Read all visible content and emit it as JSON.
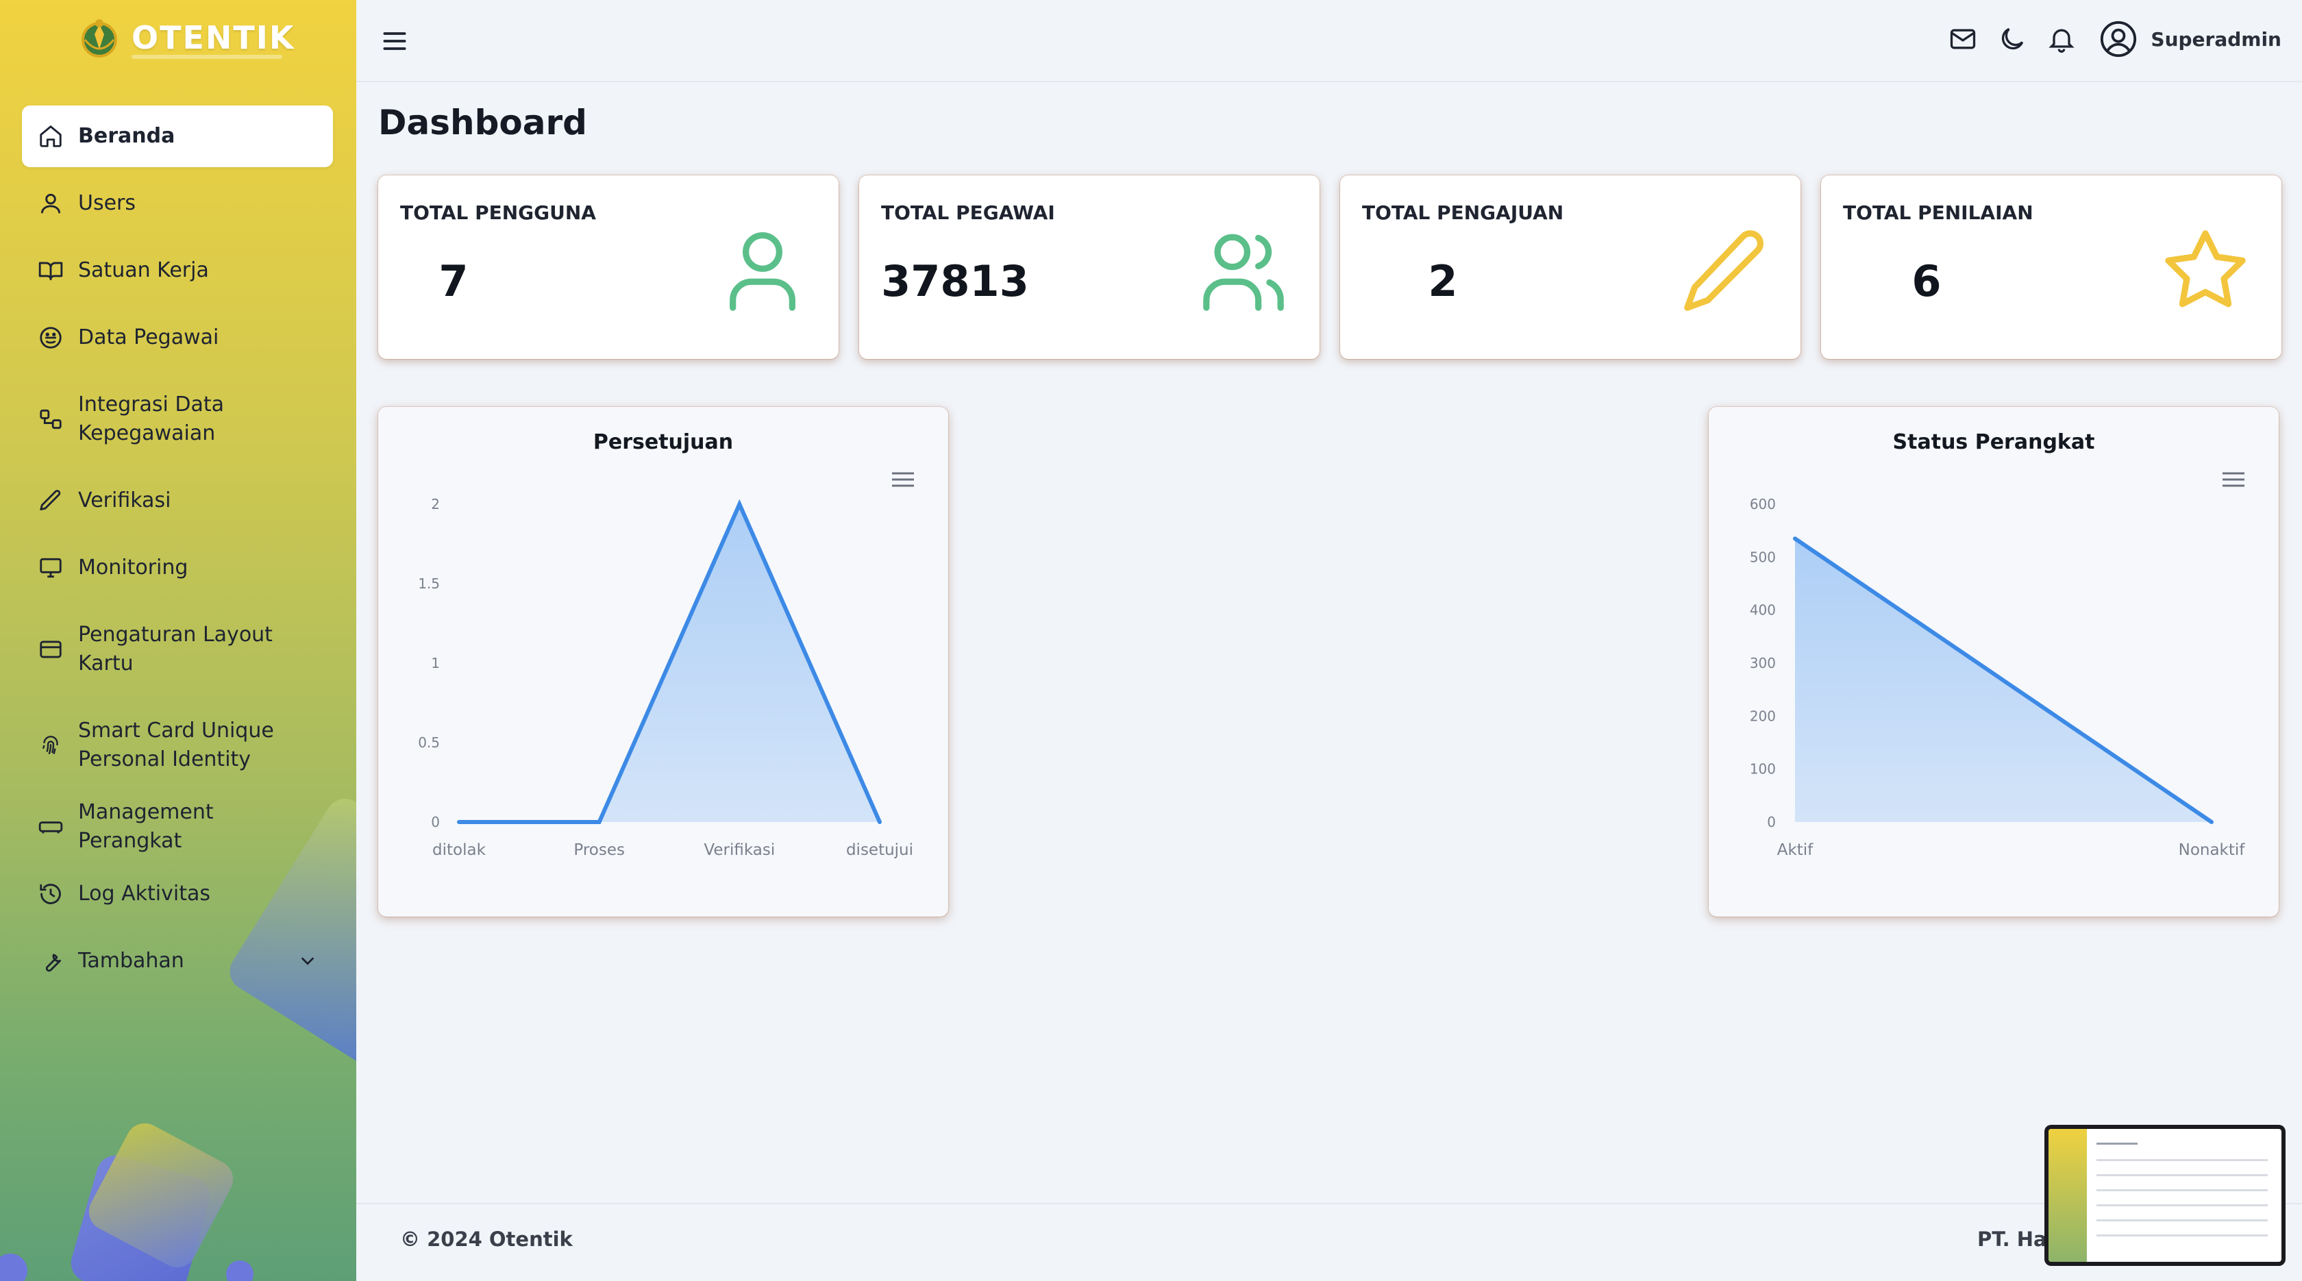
{
  "app": {
    "brand": "OTENTIK"
  },
  "sidebar": {
    "items": [
      {
        "label": "Beranda",
        "icon": "home-icon",
        "active": true
      },
      {
        "label": "Users",
        "icon": "user-icon"
      },
      {
        "label": "Satuan Kerja",
        "icon": "book-icon"
      },
      {
        "label": "Data Pegawai",
        "icon": "smile-icon"
      },
      {
        "label": "Integrasi Data\nKepegawaian",
        "icon": "integration-icon"
      },
      {
        "label": "Verifikasi",
        "icon": "pencil-icon"
      },
      {
        "label": "Monitoring",
        "icon": "monitor-icon"
      },
      {
        "label": "Pengaturan Layout\nKartu",
        "icon": "card-icon"
      },
      {
        "label": "Smart Card Unique\nPersonal Identity",
        "icon": "fingerprint-icon"
      },
      {
        "label": "Management Perangkat",
        "icon": "device-icon"
      },
      {
        "label": "Log Aktivitas",
        "icon": "history-icon"
      },
      {
        "label": "Tambahan",
        "icon": "wrench-icon",
        "has_submenu": true
      }
    ]
  },
  "header": {
    "icons": [
      "menu-icon",
      "mail-icon",
      "moon-icon",
      "bell-icon",
      "user-circle-icon"
    ],
    "username": "Superadmin"
  },
  "main": {
    "title": "Dashboard",
    "stats": [
      {
        "label": "TOTAL PENGGUNA",
        "value": "7",
        "icon": "user-icon",
        "color": "#5bbf8a"
      },
      {
        "label": "TOTAL PEGAWAI",
        "value": "37813",
        "icon": "users-icon",
        "color": "#5bbf8a"
      },
      {
        "label": "TOTAL PENGAJUAN",
        "value": "2",
        "icon": "pencil-icon",
        "color": "#f2c53d"
      },
      {
        "label": "TOTAL PENILAIAN",
        "value": "6",
        "icon": "star-icon",
        "color": "#f2c53d"
      }
    ]
  },
  "chart_data": [
    {
      "type": "area",
      "title": "Persetujuan",
      "categories": [
        "ditolak",
        "Proses",
        "Verifikasi",
        "disetujui"
      ],
      "values": [
        0,
        0,
        2,
        0
      ],
      "yticks": [
        "0",
        "0.5",
        "1",
        "1.5",
        "2"
      ],
      "ylim": [
        0,
        2
      ],
      "line_color": "#3d8ae6",
      "fill_color": "#a9ccf5"
    },
    {
      "type": "area",
      "title": "Status Perangkat",
      "categories": [
        "Aktif",
        "Nonaktif"
      ],
      "values": [
        535,
        0
      ],
      "yticks": [
        "0",
        "100",
        "200",
        "300",
        "400",
        "500",
        "600"
      ],
      "ylim": [
        0,
        600
      ],
      "line_color": "#3d8ae6",
      "fill_color": "#a9ccf5"
    }
  ],
  "footer": {
    "copyright": "© 2024 Otentik",
    "company": "PT. Har"
  }
}
